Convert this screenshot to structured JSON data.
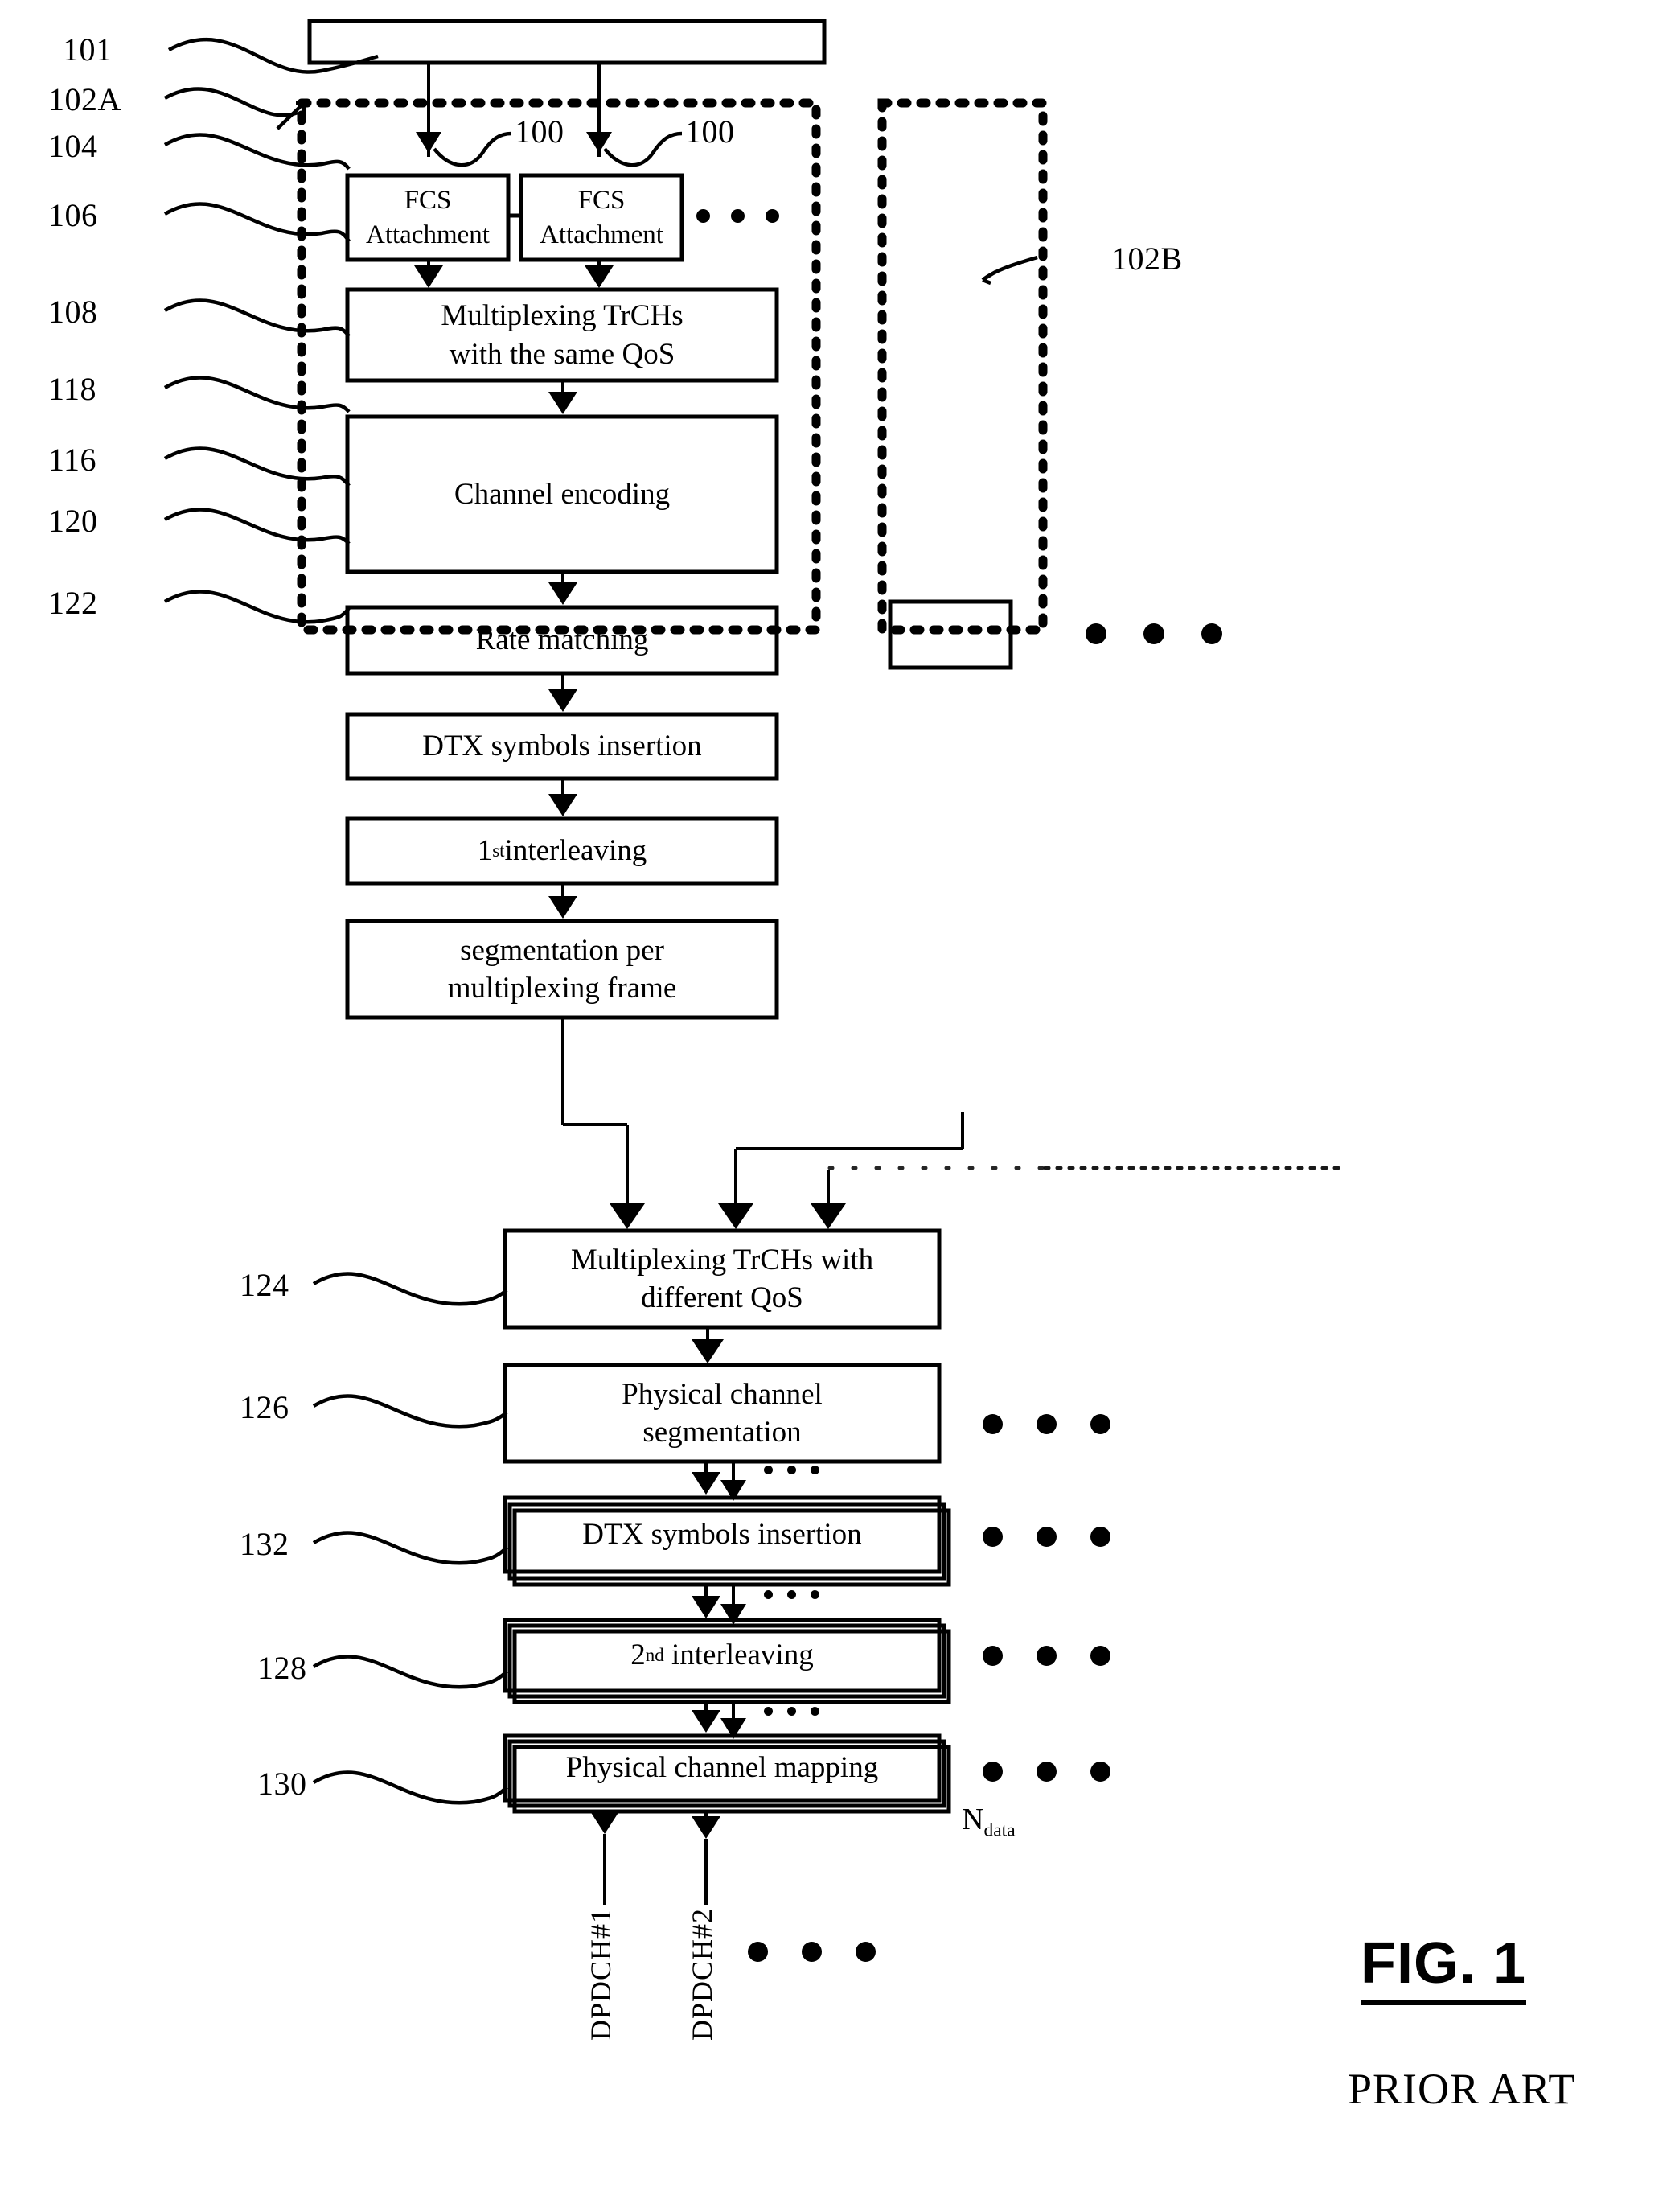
{
  "figure": {
    "title": "FIG. 1",
    "subtitle": "PRIOR ART",
    "domain_note": "3GPP transport channel multiplexing chain block diagram"
  },
  "reference_numerals": {
    "n101": "101",
    "n102A": "102A",
    "n104": "104",
    "n106": "106",
    "n108": "108",
    "n118": "118",
    "n116": "116",
    "n120": "120",
    "n122": "122",
    "n102B": "102B",
    "n124": "124",
    "n126": "126",
    "n132": "132",
    "n128": "128",
    "n130": "130",
    "n100a": "100",
    "n100b": "100"
  },
  "blocks": {
    "source_bar": "",
    "fcs_1": "FCS\nAttachment",
    "fcs_1_line1": "FCS",
    "fcs_1_line2": "Attachment",
    "fcs_2_line1": "FCS",
    "fcs_2_line2": "Attachment",
    "mux_same_qos_line1": "Multiplexing TrCHs",
    "mux_same_qos_line2": "with the same QoS",
    "channel_encoding": "Channel encoding",
    "rate_matching": "Rate matching",
    "dtx_insertion_upper": "DTX symbols insertion",
    "first_interleaving_prefix": "1",
    "first_interleaving_sup": "st",
    "first_interleaving_rest": " interleaving",
    "segmentation_line1": "segmentation per",
    "segmentation_line2": "multiplexing frame",
    "mux_diff_qos_line1": "Multiplexing TrCHs with",
    "mux_diff_qos_line2": "different QoS",
    "phy_channel_seg_line1": "Physical channel",
    "phy_channel_seg_line2": "segmentation",
    "dtx_insertion_lower": "DTX symbols insertion",
    "second_interleaving_prefix": "2",
    "second_interleaving_sup": "nd",
    "second_interleaving_rest": "interleaving",
    "phy_channel_mapping": "Physical channel mapping",
    "empty_block_102b": ""
  },
  "outputs": {
    "dpdch_1": "DPDCH#1",
    "dpdch_2": "DPDCH#2",
    "ndata_base": "N",
    "ndata_sub": "data"
  },
  "ellipses": {
    "fcs_row": "• • •",
    "right_column": "• • •",
    "stack_rows": "• • •",
    "outputs_row": "• • •"
  },
  "colors": {
    "ink": "#000000",
    "paper": "#ffffff"
  }
}
